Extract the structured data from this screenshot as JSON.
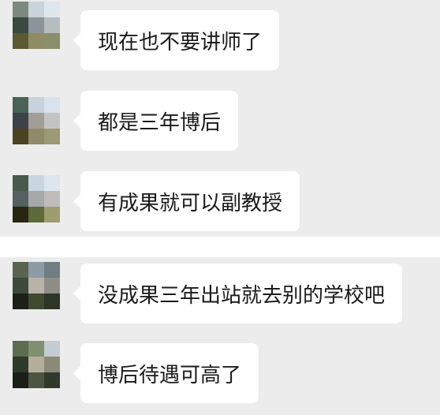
{
  "messages": [
    {
      "text": "现在也不要讲师了",
      "avatar_colors": [
        "#7b8a7c",
        "#c9d3da",
        "#dfe7ee",
        "#3a4a3e",
        "#8c949a",
        "#b8bcbf",
        "#5b5a34",
        "#8f8b64",
        "#8a8e6a"
      ]
    },
    {
      "text": "都是三年博后",
      "avatar_colors": [
        "#4a6253",
        "#c7d2dc",
        "#d8e3ee",
        "#3d4248",
        "#a29d99",
        "#c4c3c4",
        "#4b4220",
        "#8f8a6a",
        "#9a9a75"
      ]
    },
    {
      "text": "有成果就可以副教授",
      "avatar_colors": [
        "#495a4c",
        "#c9d5e0",
        "#dde6ef",
        "#556060",
        "#a6a8aa",
        "#bfbcbb",
        "#27260f",
        "#5e6a3b",
        "#9c9e70"
      ]
    },
    {
      "text": "没成果三年出站就去别的学校吧",
      "avatar_colors": [
        "#59634f",
        "#8d9ba6",
        "#6f7e81",
        "#3c4a3c",
        "#b8b2a9",
        "#8f8e86",
        "#1c2018",
        "#3f4a30",
        "#2c3526"
      ]
    },
    {
      "text": "博后待遇可高了",
      "avatar_colors": [
        "#5c6c4f",
        "#7f8f70",
        "#c4ccd2",
        "#2e3a2a",
        "#b6ae9c",
        "#8b8a78",
        "#1a1f18",
        "#4a5642",
        "#30392c"
      ]
    }
  ]
}
